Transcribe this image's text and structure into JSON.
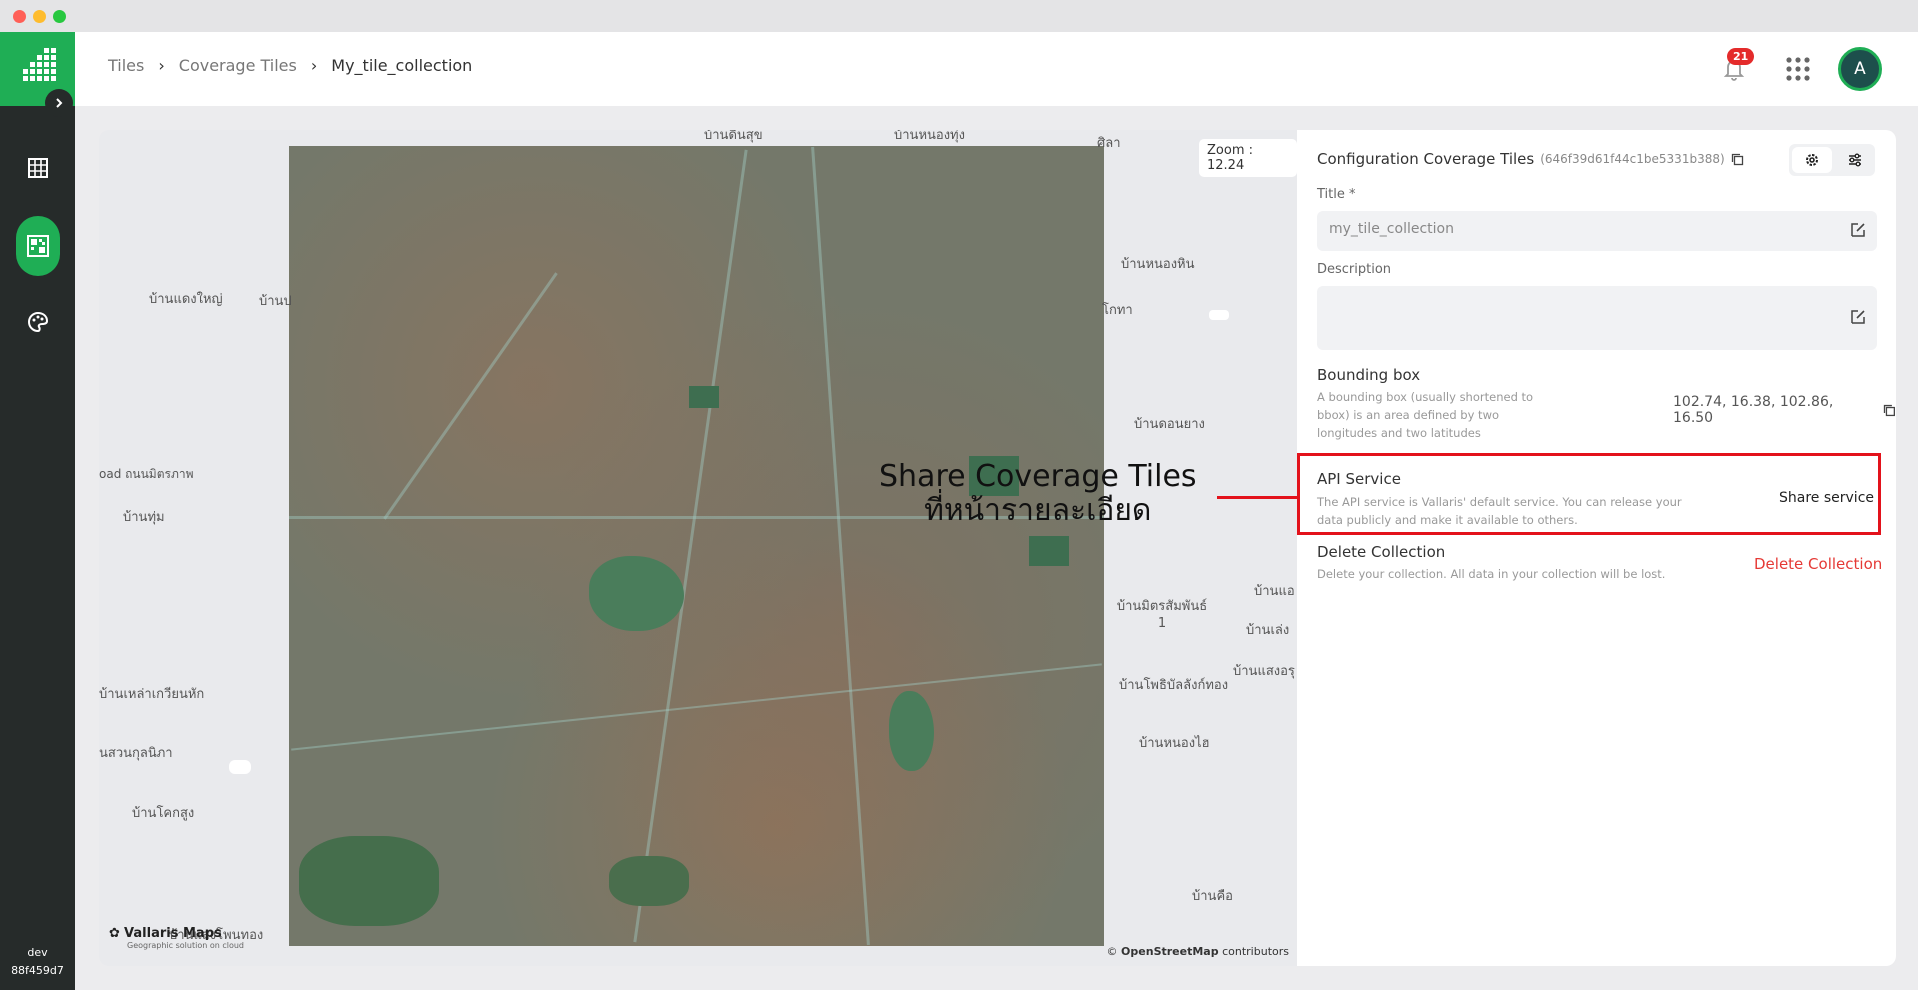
{
  "window": {
    "controls": [
      "#ff5f57",
      "#febc2e",
      "#28c840"
    ]
  },
  "sidebar": {
    "items": [
      {
        "name": "table-icon",
        "active": false
      },
      {
        "name": "tiles-icon",
        "active": true
      },
      {
        "name": "palette-icon",
        "active": false
      }
    ],
    "env": "dev",
    "build": "88f459d7"
  },
  "breadcrumb": [
    "Tiles",
    "Coverage Tiles",
    "My_tile_collection"
  ],
  "header": {
    "notification_count": "21",
    "avatar_initial": "A"
  },
  "map": {
    "zoom_label": "Zoom : 12.24",
    "labels": [
      {
        "text": "บ้านดินสุข"
      },
      {
        "text": "บ้านหนองทุ่ง"
      },
      {
        "text": "ศิลา"
      },
      {
        "text": "บ้านแดงใหญ่"
      },
      {
        "text": "บ้านป"
      },
      {
        "text": "บ้านหนองหิน"
      },
      {
        "text": "โกทา"
      },
      {
        "text": "บ้านดอนยาง"
      },
      {
        "text": "oad ถนนมิตรภาพ"
      },
      {
        "text": "บ้านทุ่ม"
      },
      {
        "text": "บ้านมิตรสัมพันธ์ 1"
      },
      {
        "text": "บ้านแอ"
      },
      {
        "text": "บ้านเล่ง"
      },
      {
        "text": "บ้านแสงอรุ"
      },
      {
        "text": "บ้านโพธิบัลลังก์ทอง"
      },
      {
        "text": "บ้านเหล่าเกวียนหัก"
      },
      {
        "text": "บ้านหนองไฮ"
      },
      {
        "text": "นสวนกุลนิภา"
      },
      {
        "text": "บ้านโคกสูง"
      },
      {
        "text": "บ้านคือ"
      },
      {
        "text": "บ้านแสงโพนทอง"
      }
    ],
    "callout_line1": "Share Coverage Tiles",
    "callout_line2": "ที่หน้ารายละเอียด",
    "brand_name": "Vallaris Maps",
    "brand_tagline": "Geographic solution on cloud",
    "attribution_prefix": "©",
    "attribution_link": "OpenStreetMap",
    "attribution_suffix": "contributors"
  },
  "panel": {
    "title": "Configuration Coverage Tiles",
    "object_id": "(646f39d61f44c1be5331b388)",
    "title_label": "Title *",
    "title_value": "my_tile_collection",
    "description_label": "Description",
    "description_value": "",
    "bbox_title": "Bounding box",
    "bbox_desc": "A bounding box (usually shortened to bbox) is an area defined by two longitudes and two latitudes",
    "bbox_value": "102.74, 16.38, 102.86, 16.50",
    "api_title": "API Service",
    "api_desc": "The API service is Vallaris' default service. You can release your data publicly and make it available to others.",
    "share_label": "Share service",
    "delete_title": "Delete Collection",
    "delete_desc": "Delete your collection. All data in your collection will be lost.",
    "delete_label": "Delete Collection"
  },
  "colors": {
    "brand": "#1fae55",
    "sidebar": "#262b2a",
    "danger": "#e53935",
    "highlight": "#e3121b"
  }
}
